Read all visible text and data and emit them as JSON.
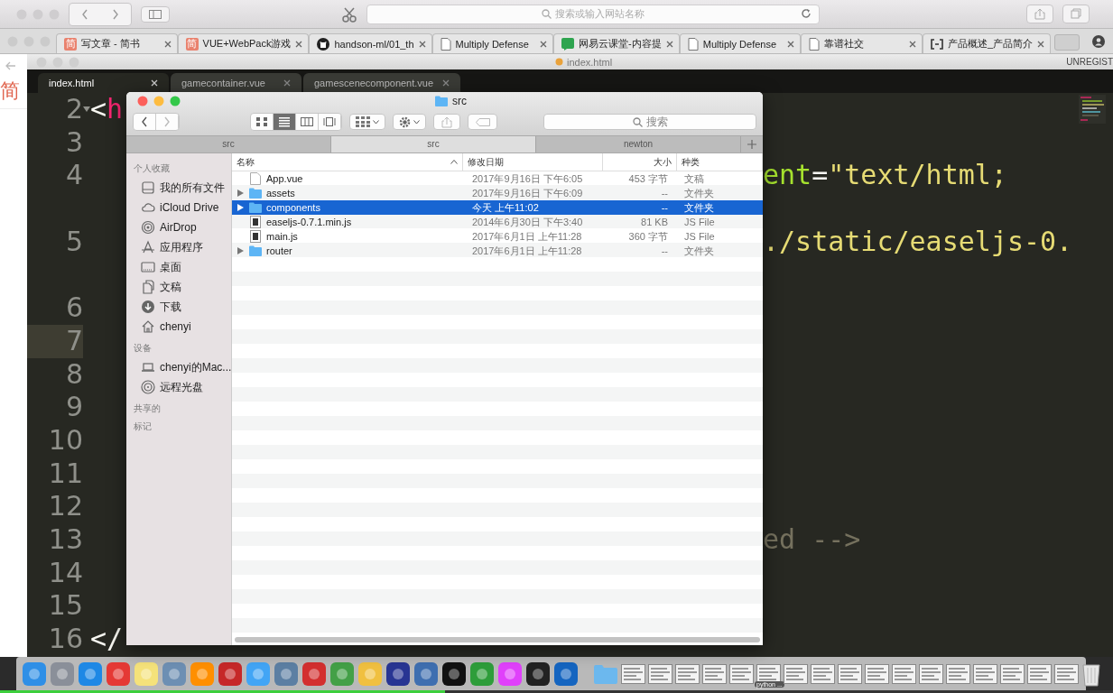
{
  "safari_toolbar": {
    "address_placeholder": "搜索或输入网站名称"
  },
  "browser_tabs": [
    {
      "title": "写文章 - 简书",
      "kind": "letter",
      "badge": "简"
    },
    {
      "title": "VUE+WebPack游戏",
      "kind": "letter",
      "badge": "简"
    },
    {
      "title": "handson-ml/01_th",
      "kind": "github"
    },
    {
      "title": "Multiply Defense",
      "kind": "page"
    },
    {
      "title": "网易云课堂-内容提",
      "kind": "chat"
    },
    {
      "title": "Multiply Defense",
      "kind": "page"
    },
    {
      "title": "靠谱社交",
      "kind": "page"
    },
    {
      "title": "产品概述_产品简介",
      "kind": "bracket"
    }
  ],
  "left_page": {
    "logo_text": "简"
  },
  "editor": {
    "title": "index.html",
    "license_text": "UNREGIST",
    "tabs": [
      {
        "label": "index.html",
        "selected": true
      },
      {
        "label": "gamecontainer.vue",
        "selected": false
      },
      {
        "label": "gamescenecomponent.vue",
        "selected": false
      }
    ],
    "lines": [
      {
        "number": "2",
        "foldable": true,
        "wrapped": false,
        "current": false,
        "left": [
          {
            "kind": "punct",
            "text": "<"
          },
          {
            "kind": "tag",
            "text": "h"
          }
        ]
      },
      {
        "number": "3",
        "foldable": false,
        "wrapped": false,
        "current": false
      },
      {
        "number": "4",
        "foldable": false,
        "wrapped": true,
        "current": false,
        "right": [
          {
            "kind": "attr",
            "text": "ent"
          },
          {
            "kind": "punct",
            "text": "="
          },
          {
            "kind": "string",
            "text": "\"text/html;"
          }
        ]
      },
      {
        "number": "5",
        "foldable": false,
        "wrapped": true,
        "current": false,
        "right": [
          {
            "kind": "string",
            "text": "./static/easeljs-0."
          }
        ]
      },
      {
        "number": "6",
        "foldable": false,
        "wrapped": false,
        "current": false
      },
      {
        "number": "7",
        "foldable": false,
        "wrapped": false,
        "current": true
      },
      {
        "number": "8",
        "foldable": false,
        "wrapped": false,
        "current": false
      },
      {
        "number": "9",
        "foldable": false,
        "wrapped": false,
        "current": false
      },
      {
        "number": "10",
        "foldable": false,
        "wrapped": false,
        "current": false
      },
      {
        "number": "11",
        "foldable": false,
        "wrapped": false,
        "current": false
      },
      {
        "number": "12",
        "foldable": false,
        "wrapped": false,
        "current": false
      },
      {
        "number": "13",
        "foldable": false,
        "wrapped": false,
        "current": false,
        "right": [
          {
            "kind": "comment",
            "text": "ed -->"
          }
        ]
      },
      {
        "number": "14",
        "foldable": false,
        "wrapped": false,
        "current": false
      },
      {
        "number": "15",
        "foldable": false,
        "wrapped": false,
        "current": false
      },
      {
        "number": "16",
        "foldable": false,
        "wrapped": false,
        "current": false,
        "left": [
          {
            "kind": "punct",
            "text": "</"
          }
        ]
      }
    ]
  },
  "finder": {
    "title": "src",
    "search_placeholder": "搜索",
    "path_tabs": [
      {
        "label": "src",
        "selected": false
      },
      {
        "label": "src",
        "selected": true
      },
      {
        "label": "newton",
        "selected": false
      }
    ],
    "sidebar": [
      {
        "heading": "个人收藏",
        "items": [
          {
            "label": "我的所有文件"
          },
          {
            "label": "iCloud Drive"
          },
          {
            "label": "AirDrop"
          },
          {
            "label": "应用程序"
          },
          {
            "label": "桌面"
          },
          {
            "label": "文稿"
          },
          {
            "label": "下载"
          },
          {
            "label": "chenyi"
          }
        ]
      },
      {
        "heading": "设备",
        "items": [
          {
            "label": "chenyi的Mac..."
          },
          {
            "label": "远程光盘"
          }
        ]
      },
      {
        "heading": "共享的"
      },
      {
        "heading": "标记"
      }
    ],
    "columns": [
      "名称",
      "修改日期",
      "大小",
      "种类"
    ],
    "rows": [
      {
        "name": "App.vue",
        "date": "2017年9月16日 下午6:05",
        "size": "453 字节",
        "type": "文稿",
        "kind": "document",
        "expandable": false,
        "selected": false
      },
      {
        "name": "assets",
        "date": "2017年9月16日 下午6:09",
        "size": "--",
        "type": "文件夹",
        "kind": "folder",
        "expandable": true,
        "selected": false
      },
      {
        "name": "components",
        "date": "今天 上午11:02",
        "size": "--",
        "type": "文件夹",
        "kind": "folder",
        "expandable": true,
        "selected": true
      },
      {
        "name": "easeljs-0.7.1.min.js",
        "date": "2014年6月30日 下午3:40",
        "size": "81 KB",
        "type": "JS File",
        "kind": "script",
        "expandable": false,
        "selected": false
      },
      {
        "name": "main.js",
        "date": "2017年6月1日 上午11:28",
        "size": "360 字节",
        "type": "JS File",
        "kind": "script",
        "expandable": false,
        "selected": false
      },
      {
        "name": "router",
        "date": "2017年6月1日 上午11:28",
        "size": "--",
        "type": "文件夹",
        "kind": "folder",
        "expandable": true,
        "selected": false
      }
    ]
  },
  "dock": [
    {
      "kind": "app",
      "color": "#2f8fe6"
    },
    {
      "kind": "app",
      "color": "#8a8f99"
    },
    {
      "kind": "app",
      "color": "#1e88e5"
    },
    {
      "kind": "app",
      "color": "#e53935"
    },
    {
      "kind": "app",
      "color": "#f5e27a"
    },
    {
      "kind": "app",
      "color": "#6d8fb3"
    },
    {
      "kind": "app",
      "color": "#ff8f00"
    },
    {
      "kind": "app",
      "color": "#c62828"
    },
    {
      "kind": "app",
      "color": "#42a5f5"
    },
    {
      "kind": "app",
      "color": "#5c7fa3"
    },
    {
      "kind": "app",
      "color": "#d32f2f"
    },
    {
      "kind": "app",
      "color": "#43a047"
    },
    {
      "kind": "app",
      "color": "#f0c040"
    },
    {
      "kind": "app",
      "color": "#283593"
    },
    {
      "kind": "app",
      "color": "#3f6fb0"
    },
    {
      "kind": "app",
      "color": "#111111"
    },
    {
      "kind": "app",
      "color": "#2e9d3a"
    },
    {
      "kind": "app",
      "color": "#e040fb"
    },
    {
      "kind": "app",
      "color": "#222222"
    },
    {
      "kind": "app",
      "color": "#1565c0"
    },
    {
      "kind": "separator"
    },
    {
      "kind": "folder"
    },
    {
      "kind": "document"
    },
    {
      "kind": "document"
    },
    {
      "kind": "document"
    },
    {
      "kind": "document"
    },
    {
      "kind": "document"
    },
    {
      "kind": "document",
      "label": "python ..."
    },
    {
      "kind": "document"
    },
    {
      "kind": "document"
    },
    {
      "kind": "document"
    },
    {
      "kind": "document"
    },
    {
      "kind": "document"
    },
    {
      "kind": "document"
    },
    {
      "kind": "document"
    },
    {
      "kind": "document"
    },
    {
      "kind": "document"
    },
    {
      "kind": "document"
    },
    {
      "kind": "document"
    },
    {
      "kind": "trash"
    }
  ],
  "playback_progress": {
    "level": 0.4
  }
}
